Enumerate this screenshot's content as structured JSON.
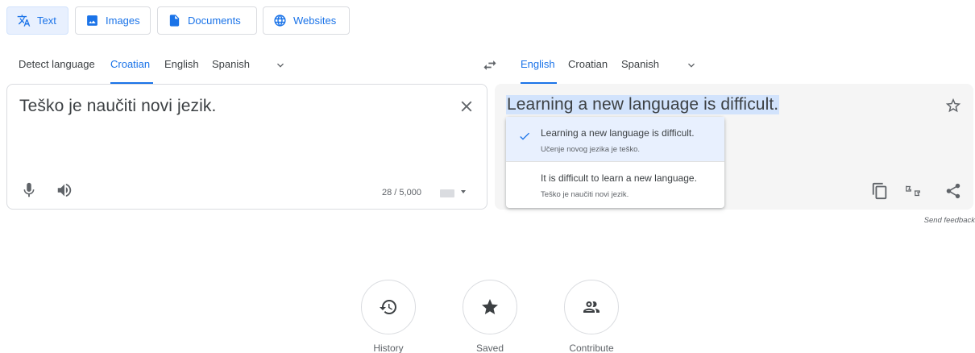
{
  "modes": [
    {
      "label": "Text",
      "icon": "translate-icon",
      "active": true
    },
    {
      "label": "Images",
      "icon": "image-icon",
      "active": false
    },
    {
      "label": "Documents",
      "icon": "document-icon",
      "active": false
    },
    {
      "label": "Websites",
      "icon": "globe-icon",
      "active": false
    }
  ],
  "source_langs": {
    "items": [
      "Detect language",
      "Croatian",
      "English",
      "Spanish"
    ],
    "active": "Croatian"
  },
  "target_langs": {
    "items": [
      "English",
      "Croatian",
      "Spanish"
    ],
    "active": "English"
  },
  "source": {
    "text": "Teško je naučiti novi jezik.",
    "counter": "28 / 5,000"
  },
  "target": {
    "text": "Learning a new language is difficult."
  },
  "alternatives": [
    {
      "main": "Learning a new language is difficult.",
      "sub": "Učenje novog jezika je teško.",
      "selected": true
    },
    {
      "main": "It is difficult to learn a new language.",
      "sub": "Teško je naučiti novi jezik.",
      "selected": false
    }
  ],
  "feedback": "Send feedback",
  "bottom": {
    "history": "History",
    "saved": "Saved",
    "contribute": "Contribute"
  },
  "colors": {
    "accent": "#1a73e8",
    "highlight": "#d2e3fc",
    "active_tab_bg": "#e8f0fe"
  }
}
